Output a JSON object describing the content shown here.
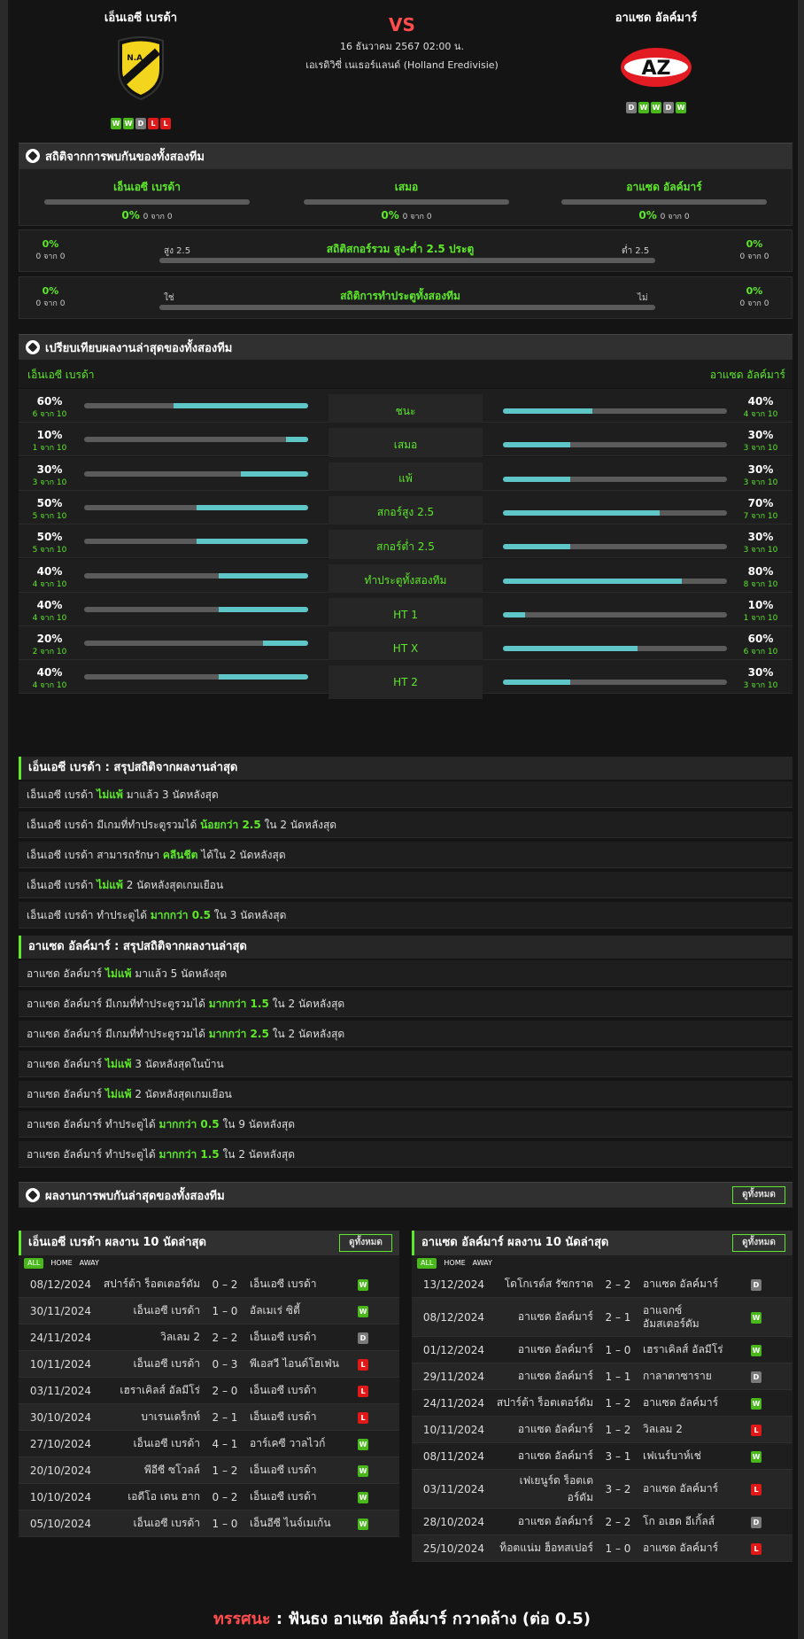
{
  "header": {
    "home": {
      "name": "เอ็นเอซี เบรด้า",
      "form": [
        "W",
        "W",
        "D",
        "L",
        "L"
      ]
    },
    "away": {
      "name": "อาแซด อัลค์มาร์",
      "form": [
        "D",
        "W",
        "W",
        "D",
        "W"
      ]
    },
    "vs": "VS",
    "datetime": "16 ธันวาคม 2567 02:00 น.",
    "league": "เอเรดิวิซี่ เนเธอร์แลนด์ (Holland Eredivisie)",
    "home_logo_text": "N.A.C.",
    "away_logo_text": "AZ"
  },
  "h2h": {
    "title": "สถิติจากการพบกันของทั้งสองทีม",
    "cols": [
      {
        "name": "เอ็นเอซี เบรด้า",
        "pct": "0%",
        "sub": "0 จาก 0"
      },
      {
        "name": "เสมอ",
        "pct": "0%",
        "sub": "0 จาก 0"
      },
      {
        "name": "อาแซด อัลค์มาร์",
        "pct": "0%",
        "sub": "0 จาก 0"
      }
    ],
    "ou": {
      "title": "สถิติสกอร์รวม สูง-ต่ำ 2.5 ประตู",
      "left_label": "สูง 2.5",
      "right_label": "ต่ำ 2.5",
      "lpct": "0%",
      "lsub": "0 จาก 0",
      "rpct": "0%",
      "rsub": "0 จาก 0"
    },
    "btts": {
      "title": "สถิติการทำประตูทั้งสองทีม",
      "left_label": "ใช่",
      "right_label": "ไม่",
      "lpct": "0%",
      "lsub": "0 จาก 0",
      "rpct": "0%",
      "rsub": "0 จาก 0"
    }
  },
  "compare": {
    "title": "เปรียบเทียบผลงานล่าสุดของทั้งสองทีม",
    "home_name": "เอ็นเอซี เบรด้า",
    "away_name": "อาแซด อัลค์มาร์",
    "rows": [
      {
        "label": "ชนะ",
        "hp": "60%",
        "hs": "6 จาก 10",
        "hv": 0.6,
        "ap": "40%",
        "as": "4 จาก 10",
        "av": 0.4
      },
      {
        "label": "เสมอ",
        "hp": "10%",
        "hs": "1 จาก 10",
        "hv": 0.1,
        "ap": "30%",
        "as": "3 จาก 10",
        "av": 0.3
      },
      {
        "label": "แพ้",
        "hp": "30%",
        "hs": "3 จาก 10",
        "hv": 0.3,
        "ap": "30%",
        "as": "3 จาก 10",
        "av": 0.3
      },
      {
        "label": "สกอร์สูง 2.5",
        "hp": "50%",
        "hs": "5 จาก 10",
        "hv": 0.5,
        "ap": "70%",
        "as": "7 จาก 10",
        "av": 0.7
      },
      {
        "label": "สกอร์ต่ำ 2.5",
        "hp": "50%",
        "hs": "5 จาก 10",
        "hv": 0.5,
        "ap": "30%",
        "as": "3 จาก 10",
        "av": 0.3
      },
      {
        "label": "ทำประตูทั้งสองทีม",
        "hp": "40%",
        "hs": "4 จาก 10",
        "hv": 0.4,
        "ap": "80%",
        "as": "8 จาก 10",
        "av": 0.8
      },
      {
        "label": "HT 1",
        "hp": "40%",
        "hs": "4 จาก 10",
        "hv": 0.4,
        "ap": "10%",
        "as": "1 จาก 10",
        "av": 0.1
      },
      {
        "label": "HT X",
        "hp": "20%",
        "hs": "2 จาก 10",
        "hv": 0.2,
        "ap": "60%",
        "as": "6 จาก 10",
        "av": 0.6
      },
      {
        "label": "HT 2",
        "hp": "40%",
        "hs": "4 จาก 10",
        "hv": 0.4,
        "ap": "30%",
        "as": "3 จาก 10",
        "av": 0.3
      }
    ]
  },
  "summary_home": {
    "title": "เอ็นเอซี เบรด้า : สรุปสถิติจากผลงานล่าสุด",
    "rows": [
      [
        {
          "t": "เอ็นเอซี เบรด้า "
        },
        {
          "t": "ไม่แพ้",
          "g": true
        },
        {
          "t": " มาแล้ว 3 นัดหลังสุด"
        }
      ],
      [
        {
          "t": "เอ็นเอซี เบรด้า มีเกมที่ทำประตูรวมได้ "
        },
        {
          "t": "น้อยกว่า 2.5",
          "g": true
        },
        {
          "t": " ใน 2 นัดหลังสุด"
        }
      ],
      [
        {
          "t": "เอ็นเอซี เบรด้า สามารถรักษา "
        },
        {
          "t": "คลีนชีต",
          "g": true
        },
        {
          "t": " ได้ใน 2 นัดหลังสุด"
        }
      ],
      [
        {
          "t": "เอ็นเอซี เบรด้า "
        },
        {
          "t": "ไม่แพ้",
          "g": true
        },
        {
          "t": " 2 นัดหลังสุดเกมเยือน"
        }
      ],
      [
        {
          "t": "เอ็นเอซี เบรด้า ทำประตูได้ "
        },
        {
          "t": "มากกว่า 0.5",
          "g": true
        },
        {
          "t": " ใน 3 นัดหลังสุด"
        }
      ]
    ]
  },
  "summary_away": {
    "title": "อาแซด อัลค์มาร์ : สรุปสถิติจากผลงานล่าสุด",
    "rows": [
      [
        {
          "t": "อาแซด อัลค์มาร์ "
        },
        {
          "t": "ไม่แพ้",
          "g": true
        },
        {
          "t": " มาแล้ว 5 นัดหลังสุด"
        }
      ],
      [
        {
          "t": "อาแซด อัลค์มาร์ มีเกมที่ทำประตูรวมได้ "
        },
        {
          "t": "มากกว่า 1.5",
          "g": true
        },
        {
          "t": " ใน 2 นัดหลังสุด"
        }
      ],
      [
        {
          "t": "อาแซด อัลค์มาร์ มีเกมที่ทำประตูรวมได้ "
        },
        {
          "t": "มากกว่า 2.5",
          "g": true
        },
        {
          "t": " ใน 2 นัดหลังสุด"
        }
      ],
      [
        {
          "t": "อาแซด อัลค์มาร์ "
        },
        {
          "t": "ไม่แพ้",
          "g": true
        },
        {
          "t": " 3 นัดหลังสุดในบ้าน"
        }
      ],
      [
        {
          "t": "อาแซด อัลค์มาร์ "
        },
        {
          "t": "ไม่แพ้",
          "g": true
        },
        {
          "t": " 2 นัดหลังสุดเกมเยือน"
        }
      ],
      [
        {
          "t": "อาแซด อัลค์มาร์ ทำประตูได้ "
        },
        {
          "t": "มากกว่า 0.5",
          "g": true
        },
        {
          "t": " ใน 9 นัดหลังสุด"
        }
      ],
      [
        {
          "t": "อาแซด อัลค์มาร์ ทำประตูได้ "
        },
        {
          "t": "มากกว่า 1.5",
          "g": true
        },
        {
          "t": " ใน 2 นัดหลังสุด"
        }
      ]
    ]
  },
  "recent": {
    "title": "ผลงานการพบกันล่าสุดของทั้งสองทีม",
    "view_all": "ดูทั้งหมด",
    "tabs": [
      "ALL",
      "HOME",
      "AWAY"
    ]
  },
  "home_last": {
    "title": "เอ็นเอซี เบรด้า ผลงาน 10 นัดล่าสุด",
    "view_all": "ดูทั้งหมด",
    "matches": [
      {
        "date": "08/12/2024",
        "home": "สปาร์ต้า ร็อตเตอร์ดัม",
        "score": "0 – 2",
        "away": "เอ็นเอซี เบรด้า",
        "res": "W"
      },
      {
        "date": "30/11/2024",
        "home": "เอ็นเอซี เบรด้า",
        "score": "1 – 0",
        "away": "อัลเมเร่ ซิตี้",
        "res": "W"
      },
      {
        "date": "24/11/2024",
        "home": "วิลเลม 2",
        "score": "2 – 2",
        "away": "เอ็นเอซี เบรด้า",
        "res": "D"
      },
      {
        "date": "10/11/2024",
        "home": "เอ็นเอซี เบรด้า",
        "score": "0 – 3",
        "away": "พีเอสวี ไอนด์โฮเฟ่น",
        "res": "L"
      },
      {
        "date": "03/11/2024",
        "home": "เฮราเคิลส์ อัลมีโร่",
        "score": "2 – 0",
        "away": "เอ็นเอซี เบรด้า",
        "res": "L"
      },
      {
        "date": "30/10/2024",
        "home": "บาเรนเดร็กท์",
        "score": "2 – 1",
        "away": "เอ็นเอซี เบรด้า",
        "res": "L"
      },
      {
        "date": "27/10/2024",
        "home": "เอ็นเอซี เบรด้า",
        "score": "4 – 1",
        "away": "อาร์เคซี วาลไวก์",
        "res": "W"
      },
      {
        "date": "20/10/2024",
        "home": "พีอีซี ซโวลล์",
        "score": "1 – 2",
        "away": "เอ็นเอซี เบรด้า",
        "res": "W"
      },
      {
        "date": "10/10/2024",
        "home": "เอดีโอ เดน ฮาก",
        "score": "0 – 2",
        "away": "เอ็นเอซี เบรด้า",
        "res": "W"
      },
      {
        "date": "05/10/2024",
        "home": "เอ็นเอซี เบรด้า",
        "score": "1 – 0",
        "away": "เอ็นอีซี ไนจ์เมเก้น",
        "res": "W"
      }
    ]
  },
  "away_last": {
    "title": "อาแซด อัลค์มาร์ ผลงาน 10 นัดล่าสุด",
    "view_all": "ดูทั้งหมด",
    "matches": [
      {
        "date": "13/12/2024",
        "home": "โดโกเรต์ส รัซกราด",
        "score": "2 – 2",
        "away": "อาแซด อัลค์มาร์",
        "res": "D"
      },
      {
        "date": "08/12/2024",
        "home": "อาแซด อัลค์มาร์",
        "score": "2 – 1",
        "away": "อาแจกซ์ อัมสเตอร์ดัม",
        "res": "W"
      },
      {
        "date": "01/12/2024",
        "home": "อาแซด อัลค์มาร์",
        "score": "1 – 0",
        "away": "เฮราเคิลส์ อัลมีโร่",
        "res": "W"
      },
      {
        "date": "29/11/2024",
        "home": "อาแซด อัลค์มาร์",
        "score": "1 – 1",
        "away": "กาลาตาซาราย",
        "res": "D"
      },
      {
        "date": "24/11/2024",
        "home": "สปาร์ต้า ร็อตเตอร์ดัม",
        "score": "1 – 2",
        "away": "อาแซด อัลค์มาร์",
        "res": "W"
      },
      {
        "date": "10/11/2024",
        "home": "อาแซด อัลค์มาร์",
        "score": "1 – 2",
        "away": "วิลเลม 2",
        "res": "L"
      },
      {
        "date": "08/11/2024",
        "home": "อาแซด อัลค์มาร์",
        "score": "3 – 1",
        "away": "เฟเนร์บาห์เช่",
        "res": "W"
      },
      {
        "date": "03/11/2024",
        "home": "เฟเยนูร์ด ร็อตเตอร์ดัม",
        "score": "3 – 2",
        "away": "อาแซด อัลค์มาร์",
        "res": "L"
      },
      {
        "date": "28/10/2024",
        "home": "อาแซด อัลค์มาร์",
        "score": "2 – 2",
        "away": "โก อเฮด อีเกิ้ลส์",
        "res": "D"
      },
      {
        "date": "25/10/2024",
        "home": "ท็อตแน่ม ฮ็อทสเปอร์",
        "score": "1 – 0",
        "away": "อาแซด อัลค์มาร์",
        "res": "L"
      }
    ]
  },
  "prediction": {
    "label": "ทรรศนะ",
    "sep": " : ",
    "text": "ฟันธง อาแซด อัลค์มาร์ กวาดล้าง (ต่อ 0.5)"
  },
  "colors": {
    "accent": "#5ee82a",
    "bar_fill": "#5ec6c6",
    "win": "#49b81a",
    "draw": "#7a7a7a",
    "loss": "#e01818",
    "prediction": "#ff4d4d"
  }
}
